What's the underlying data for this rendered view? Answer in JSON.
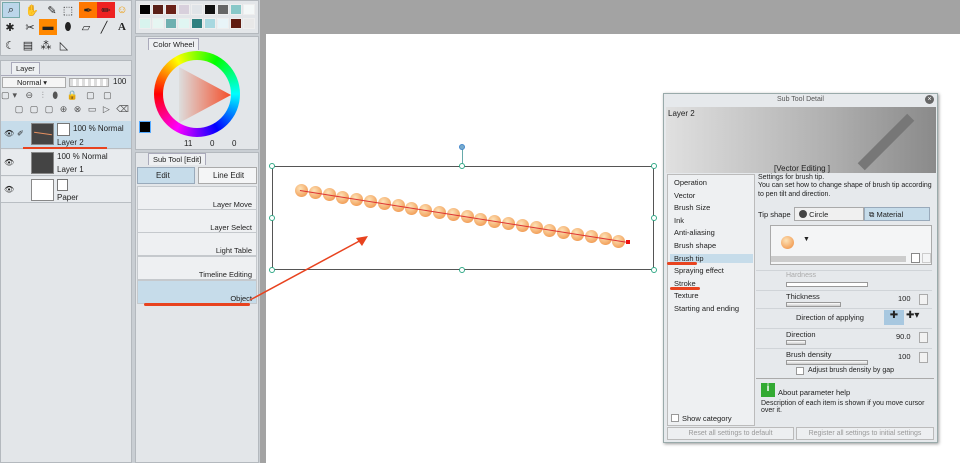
{
  "layer_panel": {
    "tab": "Layer",
    "blend_mode": "Normal",
    "opacity": "100",
    "layers": [
      {
        "opacity_mode": "100 % Normal",
        "name": "Layer 2"
      },
      {
        "opacity_mode": "100 % Normal",
        "name": "Layer 1"
      },
      {
        "name": "Paper"
      }
    ]
  },
  "color_wheel": {
    "tab": "Color Wheel",
    "readout": [
      "11",
      "0",
      "0"
    ]
  },
  "palette": {
    "colors": [
      "#000000",
      "#5a2018",
      "#6b2218",
      "#d8d0dc",
      "#e0e4e8",
      "#111111",
      "#666666",
      "#88c8c8",
      "#f4f8f8",
      "#d8f4ee",
      "#e6f6f2",
      "#6fb0b0",
      "#e0f6f2",
      "#2f8080",
      "#a8d8e0",
      "#e8f4f8",
      "#601c10",
      "#e8e8e8"
    ]
  },
  "sub_tool": {
    "tab": "Sub Tool [Edit]",
    "edit": "Edit",
    "line_edit": "Line Edit",
    "items": [
      "Layer Move",
      "Layer Select",
      "Light Table",
      "Timeline Editing",
      "Object"
    ]
  },
  "dialog": {
    "title": "Sub Tool Detail",
    "preview_layer": "Layer 2",
    "preview_caption": "[Vector Editing ]",
    "categories": [
      "Operation",
      "Vector",
      "Brush Size",
      "Ink",
      "Anti-aliasing",
      "Brush shape",
      "Brush tip",
      "Spraying effect",
      "Stroke",
      "Texture",
      "Starting and ending"
    ],
    "selected_category": "Brush tip",
    "desc": "Settings for brush tip.\nYou can set how to change shape of brush tip according to pen tilt and direction.",
    "tip_shape_label": "Tip shape",
    "circle": "Circle",
    "material": "Material",
    "hardness": "Hardness",
    "thickness": "Thickness",
    "thickness_value": "100",
    "direction_of_applying": "Direction of applying",
    "direction": "Direction",
    "direction_value": "90.0",
    "brush_density": "Brush density",
    "brush_density_value": "100",
    "adjust_density": "Adjust brush density by gap",
    "help_title": "About parameter help",
    "help_text": "Description of each item is shown if you move cursor over it.",
    "show_category": "Show category",
    "reset": "Reset all settings to default",
    "register": "Register all settings to initial settings"
  },
  "colors": {
    "accent_red": "#e8431f",
    "selection": "#3aa57a",
    "highlight": "#c6dcea"
  }
}
